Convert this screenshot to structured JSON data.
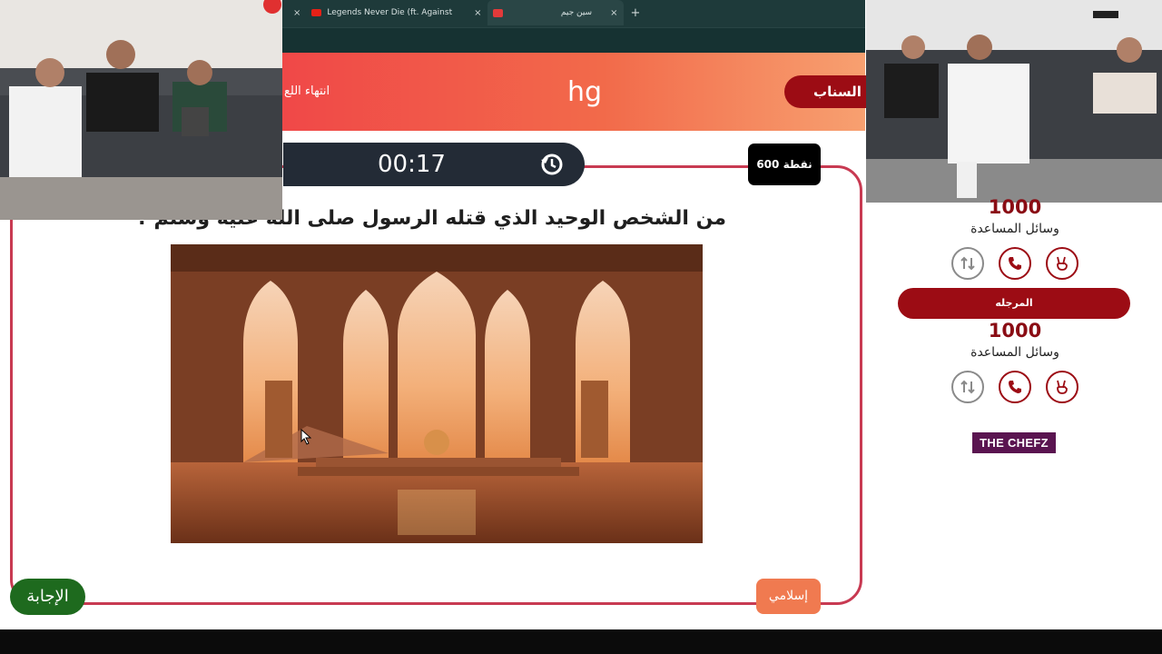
{
  "browser": {
    "tabs": [
      {
        "title": "Legends Never Die (ft. Against",
        "close": "×"
      },
      {
        "title": "سين جيم",
        "close": "×"
      }
    ],
    "new_tab": "+"
  },
  "header": {
    "team_center": "hg",
    "end_game": "انتهاء اللع",
    "active_team": "السناب"
  },
  "question_panel": {
    "timer": "00:17",
    "points": "600 نقطة",
    "question": "من الشخص الوحيد الذي قتله الرسول صلى الله عليه وسلم ؟",
    "answer_button": "الإجابة",
    "category": "إسلامي"
  },
  "sidebar": {
    "team1": {
      "score": "1000",
      "aids_label": "وسائل المساعدة"
    },
    "team2": {
      "name": "المرجله",
      "score": "1000",
      "aids_label": "وسائل المساعدة"
    },
    "sponsor": "THE CHEFZ"
  },
  "colors": {
    "accent": "#9c0c14",
    "frame": "#c83a52",
    "header_start": "#f04848",
    "header_end": "#f7a070",
    "answer": "#1e6a1e",
    "category": "#f07a50"
  }
}
